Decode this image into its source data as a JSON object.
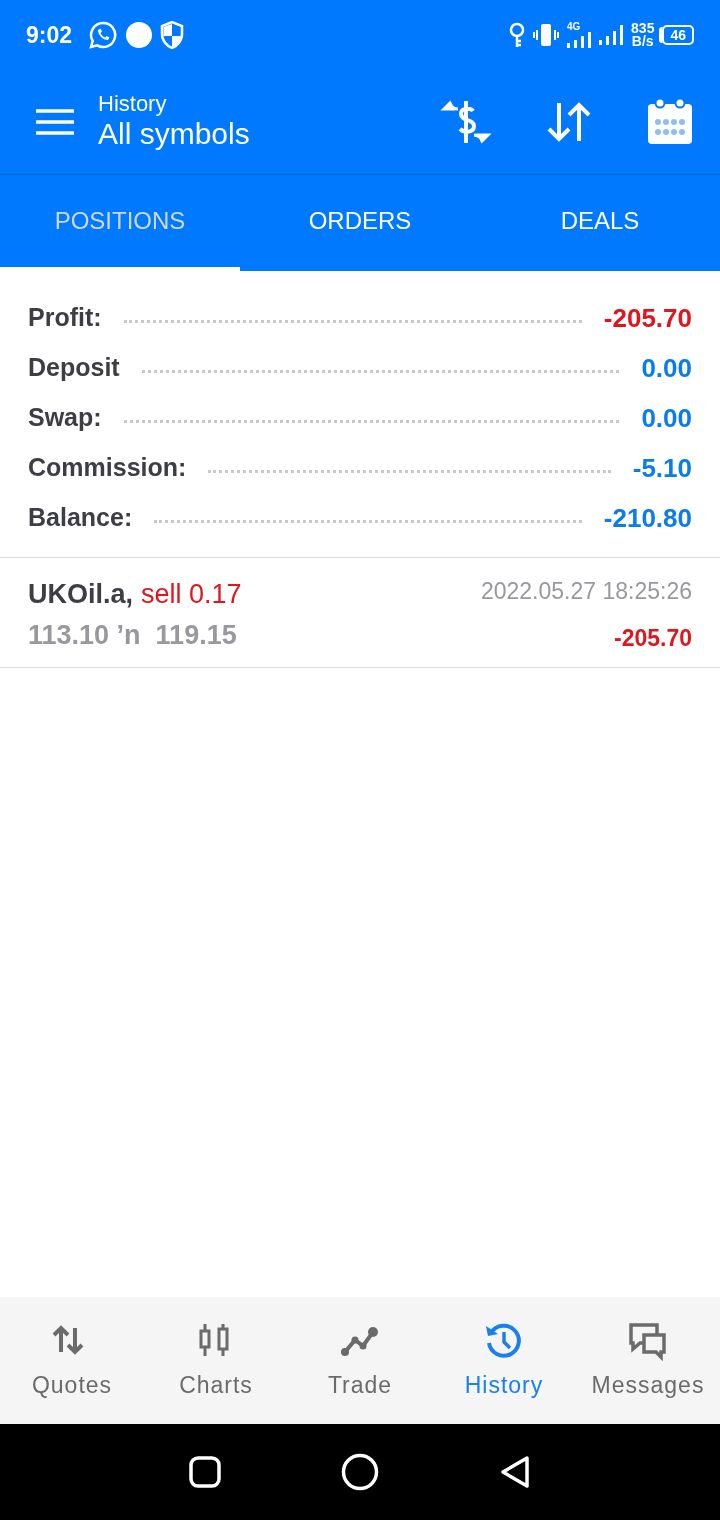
{
  "status_bar": {
    "time": "9:02",
    "network": "4G",
    "speed": "835",
    "speed_unit": "B/s",
    "battery": "46"
  },
  "header": {
    "subtitle": "History",
    "title": "All symbols"
  },
  "tabs": [
    {
      "label": "POSITIONS",
      "selected": true
    },
    {
      "label": "ORDERS",
      "selected": false
    },
    {
      "label": "DEALS",
      "selected": false
    }
  ],
  "summary": [
    {
      "label": "Profit:",
      "value": "-205.70",
      "color": "#e0161e"
    },
    {
      "label": "Deposit",
      "value": "0.00",
      "color": "#0a7cf0"
    },
    {
      "label": "Swap:",
      "value": "0.00",
      "color": "#0a7cf0"
    },
    {
      "label": "Commission:",
      "value": "-5.10",
      "color": "#0a7cf0"
    },
    {
      "label": "Balance:",
      "value": "-210.80",
      "color": "#0a7cf0"
    }
  ],
  "positions": [
    {
      "symbol": "UKOil.a,",
      "side": "sell 0.17",
      "prices": "113.10 ’n  119.15",
      "time": "2022.05.27 18:25:26",
      "profit": "-205.70"
    }
  ],
  "bottom_nav": [
    {
      "label": "Quotes",
      "selected": false
    },
    {
      "label": "Charts",
      "selected": false
    },
    {
      "label": "Trade",
      "selected": false
    },
    {
      "label": "History",
      "selected": true
    },
    {
      "label": "Messages",
      "selected": false
    }
  ]
}
